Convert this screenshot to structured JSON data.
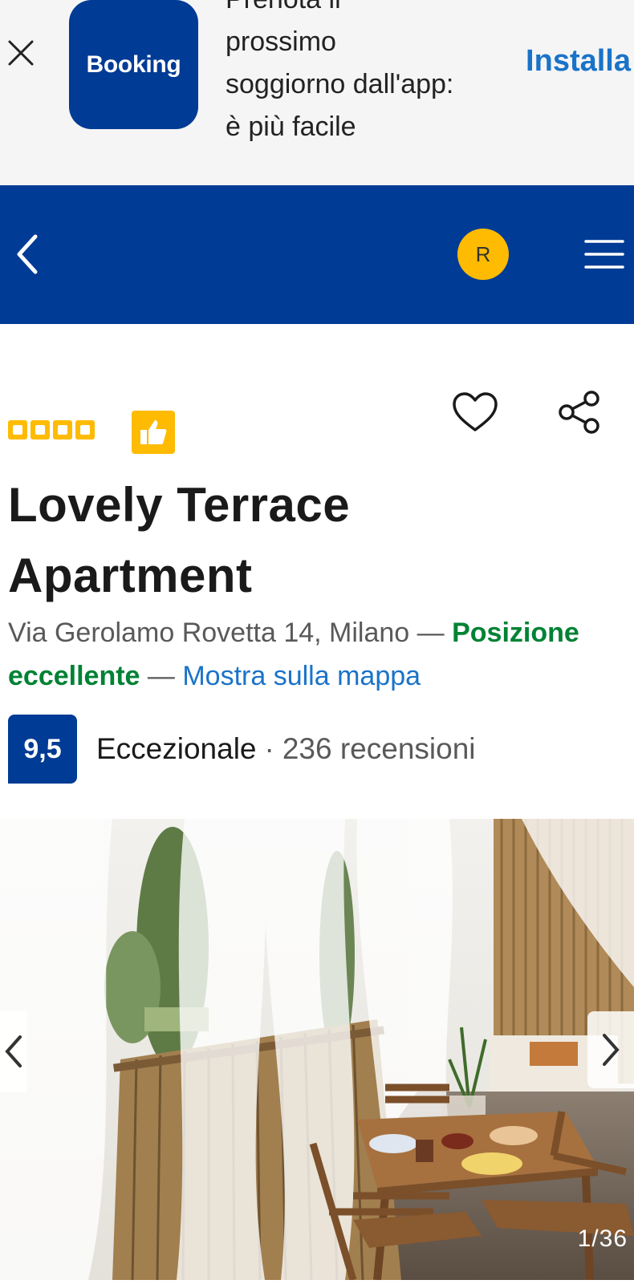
{
  "app_banner": {
    "brand": "Booking",
    "lines": [
      "Prenota il",
      "prossimo",
      "soggiorno dall'app:",
      "è più facile"
    ],
    "install_label": "Installa",
    "close_icon": "close-icon"
  },
  "header": {
    "back_icon": "chevron-left-icon",
    "avatar_initial": "R",
    "menu_icon": "hamburger-menu-icon",
    "colors": {
      "brand_blue": "#003b95",
      "avatar_yellow": "#febb02"
    }
  },
  "property": {
    "rating_squares": 4,
    "title": "Lovely Terrace Apartment",
    "address": "Via Gerolamo Rovetta 14, Milano",
    "dash": "—",
    "location_rating": "Posizione eccellente",
    "map_link": "Mostra sulla mappa",
    "score": "9,5",
    "score_label": "Eccezionale",
    "separator": "·",
    "reviews": "236 recensioni"
  },
  "gallery": {
    "counter": "1/36",
    "prev_icon": "chevron-left-icon",
    "next_icon": "chevron-right-icon"
  }
}
